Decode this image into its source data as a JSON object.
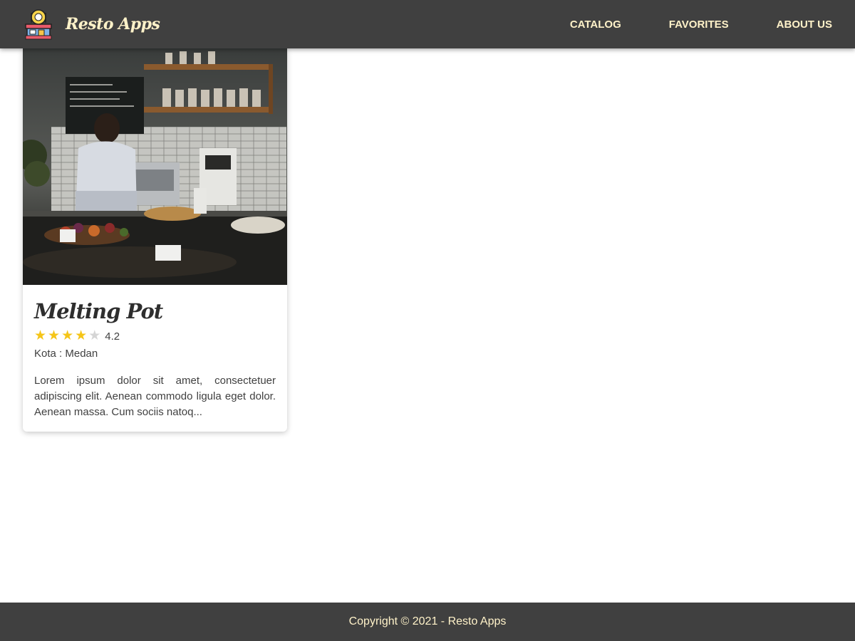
{
  "header": {
    "brand_name": "Resto Apps",
    "logo_icon": "restaurant-storefront-icon",
    "nav": [
      {
        "label": "CATALOG"
      },
      {
        "label": "FAVORITES"
      },
      {
        "label": "ABOUT US"
      }
    ]
  },
  "restaurants": [
    {
      "name": "Melting Pot",
      "rating": 4.2,
      "rating_text": "4.2",
      "stars_max": 5,
      "city_label": "Kota : ",
      "city": "Medan",
      "description": "Lorem ipsum dolor sit amet, consectetuer adipiscing elit. Aenean commodo ligula eget dolor. Aenean massa. Cum sociis natoq...",
      "image_icon": "cafe-kitchen-photo"
    }
  ],
  "footer": {
    "copyright": "Copyright © 2021 - Resto Apps"
  },
  "colors": {
    "bar_background": "#404040",
    "accent_text": "#fff2c9",
    "star_filled": "#f5c518",
    "star_empty": "#d5d5d5"
  }
}
